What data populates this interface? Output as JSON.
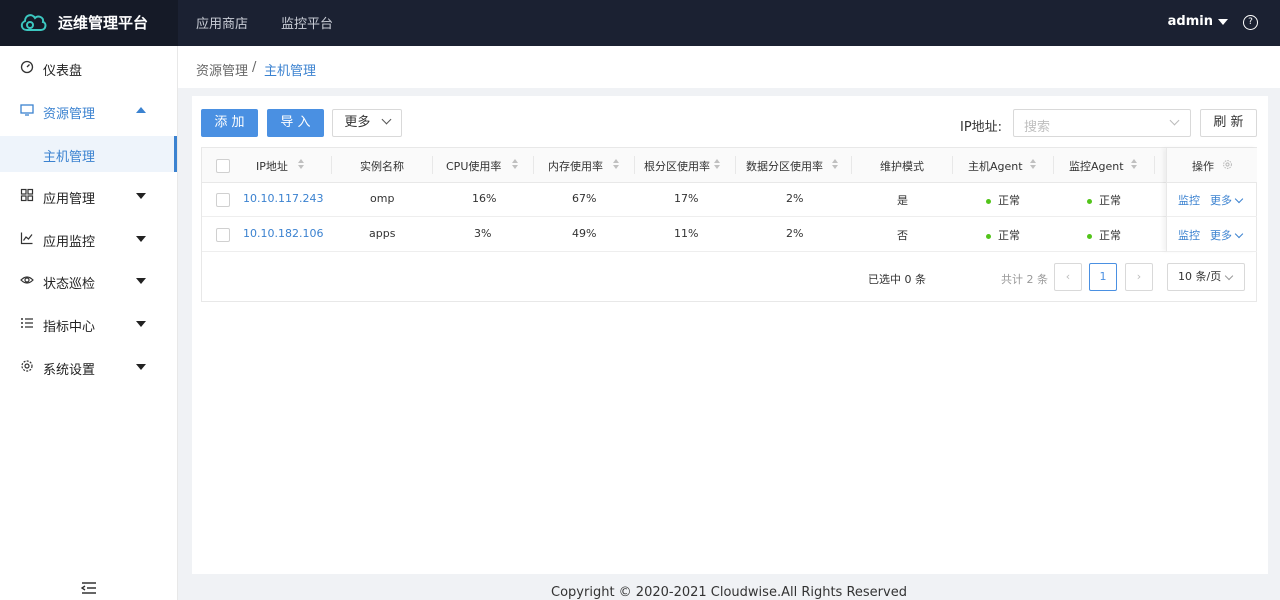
{
  "app": {
    "title": "运维管理平台"
  },
  "topnav": [
    {
      "label": "应用商店"
    },
    {
      "label": "监控平台"
    }
  ],
  "user": {
    "name": "admin",
    "help": "?"
  },
  "sidebar": {
    "items": [
      {
        "label": "仪表盘"
      },
      {
        "label": "资源管理"
      },
      {
        "label": "应用管理"
      },
      {
        "label": "应用监控"
      },
      {
        "label": "状态巡检"
      },
      {
        "label": "指标中心"
      },
      {
        "label": "系统设置"
      }
    ],
    "sub_item": "主机管理"
  },
  "breadcrumb": {
    "parent": "资源管理",
    "separator": "/",
    "current": "主机管理"
  },
  "toolbar": {
    "add": "添 加",
    "import": "导 入",
    "more": "更多",
    "search_label": "IP地址:",
    "search_placeholder": "搜索",
    "refresh": "刷 新"
  },
  "table": {
    "columns": [
      "IP地址",
      "实例名称",
      "CPU使用率",
      "内存使用率",
      "根分区使用率",
      "数据分区使用率",
      "维护模式",
      "主机Agent",
      "监控Agent",
      "操作"
    ],
    "rows": [
      {
        "ip": "10.10.117.243",
        "name": "omp",
        "cpu": "16%",
        "mem": "67%",
        "root": "17%",
        "data": "2%",
        "maint": "是",
        "host_agent": "正常",
        "mon_agent": "正常",
        "op_monitor": "监控",
        "op_more": "更多"
      },
      {
        "ip": "10.10.182.106",
        "name": "apps",
        "cpu": "3%",
        "mem": "49%",
        "root": "11%",
        "data": "2%",
        "maint": "否",
        "host_agent": "正常",
        "mon_agent": "正常",
        "op_monitor": "监控",
        "op_more": "更多"
      }
    ]
  },
  "pagination": {
    "selected": "已选中 0 条",
    "total": "共计 2 条",
    "current_page": "1",
    "page_size": "10 条/页"
  },
  "footer": {
    "copyright": "Copyright © 2020-2021 Cloudwise.All Rights Reserved"
  },
  "colors": {
    "primary": "#4a90e2",
    "topbar": "#1b2132",
    "ok": "#52c41a"
  }
}
